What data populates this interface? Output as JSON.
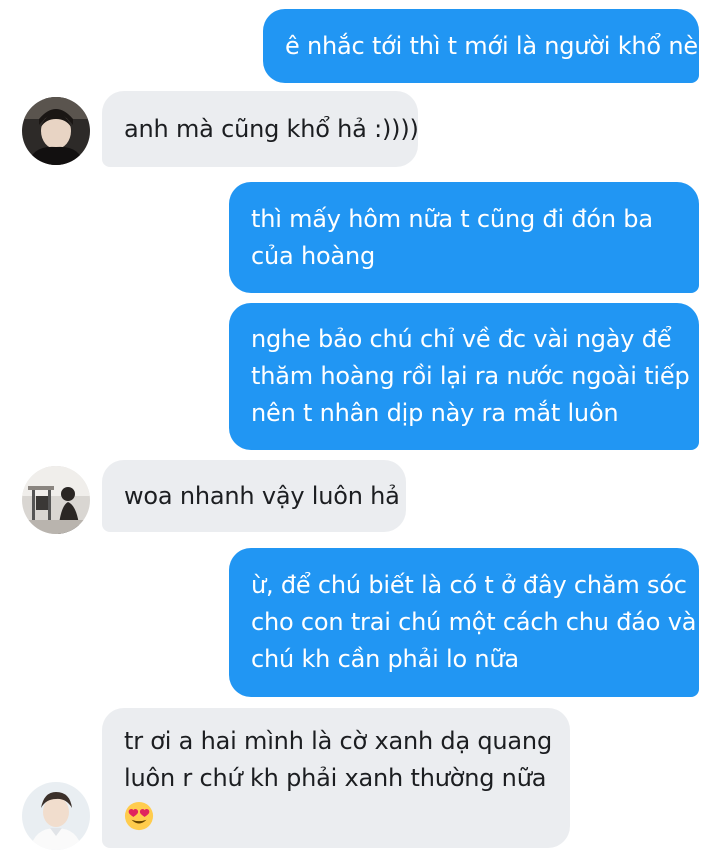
{
  "messages": [
    {
      "id": "m1",
      "direction": "outgoing",
      "lines": [
        "ê nhắc tới thì t mới là người khổ nè"
      ]
    },
    {
      "id": "m2",
      "direction": "incoming",
      "avatar": "dark-hoodie-avatar",
      "lines": [
        "anh mà cũng khổ hả :))))"
      ]
    },
    {
      "id": "m3",
      "direction": "outgoing",
      "lines": [
        "thì mấy hôm nữa t cũng đi đón ba",
        "của hoàng"
      ]
    },
    {
      "id": "m4",
      "direction": "outgoing",
      "lines": [
        "nghe bảo chú chỉ về đc vài ngày để",
        "thăm hoàng rồi lại ra nước ngoài tiếp",
        "nên t nhân dịp này ra mắt luôn"
      ]
    },
    {
      "id": "m5",
      "direction": "incoming",
      "avatar": "room-photo-avatar",
      "lines": [
        "woa nhanh vậy luôn hả"
      ]
    },
    {
      "id": "m6",
      "direction": "outgoing",
      "lines": [
        "ừ, để chú biết là có t ở đây chăm sóc",
        "cho con trai chú một cách chu đáo và",
        "chú kh cần phải lo nữa"
      ]
    },
    {
      "id": "m7",
      "direction": "incoming",
      "avatar": "white-shirt-avatar",
      "lines": [
        "tr ơi a hai mình là cờ xanh dạ quang",
        "luôn r chứ kh phải xanh thường nữa"
      ],
      "emoji": "heart-eyes-emoji"
    }
  ],
  "colors": {
    "outgoing_bubble": "#2196f3",
    "incoming_bubble": "#ebedf0",
    "outgoing_text": "#ffffff",
    "incoming_text": "#1c1e21"
  }
}
